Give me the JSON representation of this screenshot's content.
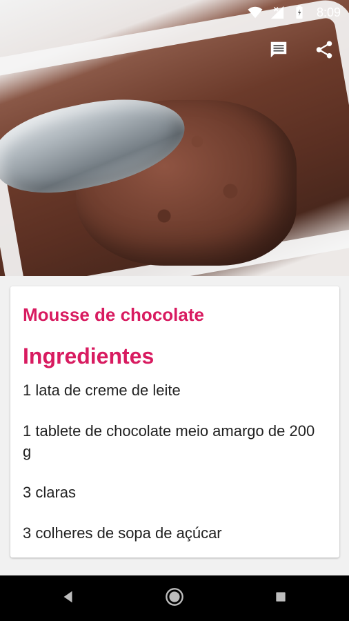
{
  "status_bar": {
    "time": "8:09",
    "icons": [
      "wifi-icon",
      "signal-icon",
      "battery-icon"
    ]
  },
  "action_bar": {
    "buttons": [
      {
        "name": "comments-icon"
      },
      {
        "name": "share-icon"
      }
    ]
  },
  "hero": {
    "subject": "chocolate mousse in white dish with spoon"
  },
  "recipe": {
    "title": "Mousse de chocolate",
    "ingredients_heading": "Ingredientes",
    "ingredients": [
      "1 lata de creme de leite",
      "1 tablete de chocolate meio amargo de 200 g",
      "3 claras",
      "3 colheres de sopa de açúcar"
    ]
  },
  "nav_bar": {
    "buttons": [
      "back-icon",
      "home-icon",
      "recents-icon"
    ]
  },
  "colors": {
    "accent": "#d81b60",
    "text": "#212121",
    "background": "#f1f1f1",
    "card": "#ffffff"
  }
}
